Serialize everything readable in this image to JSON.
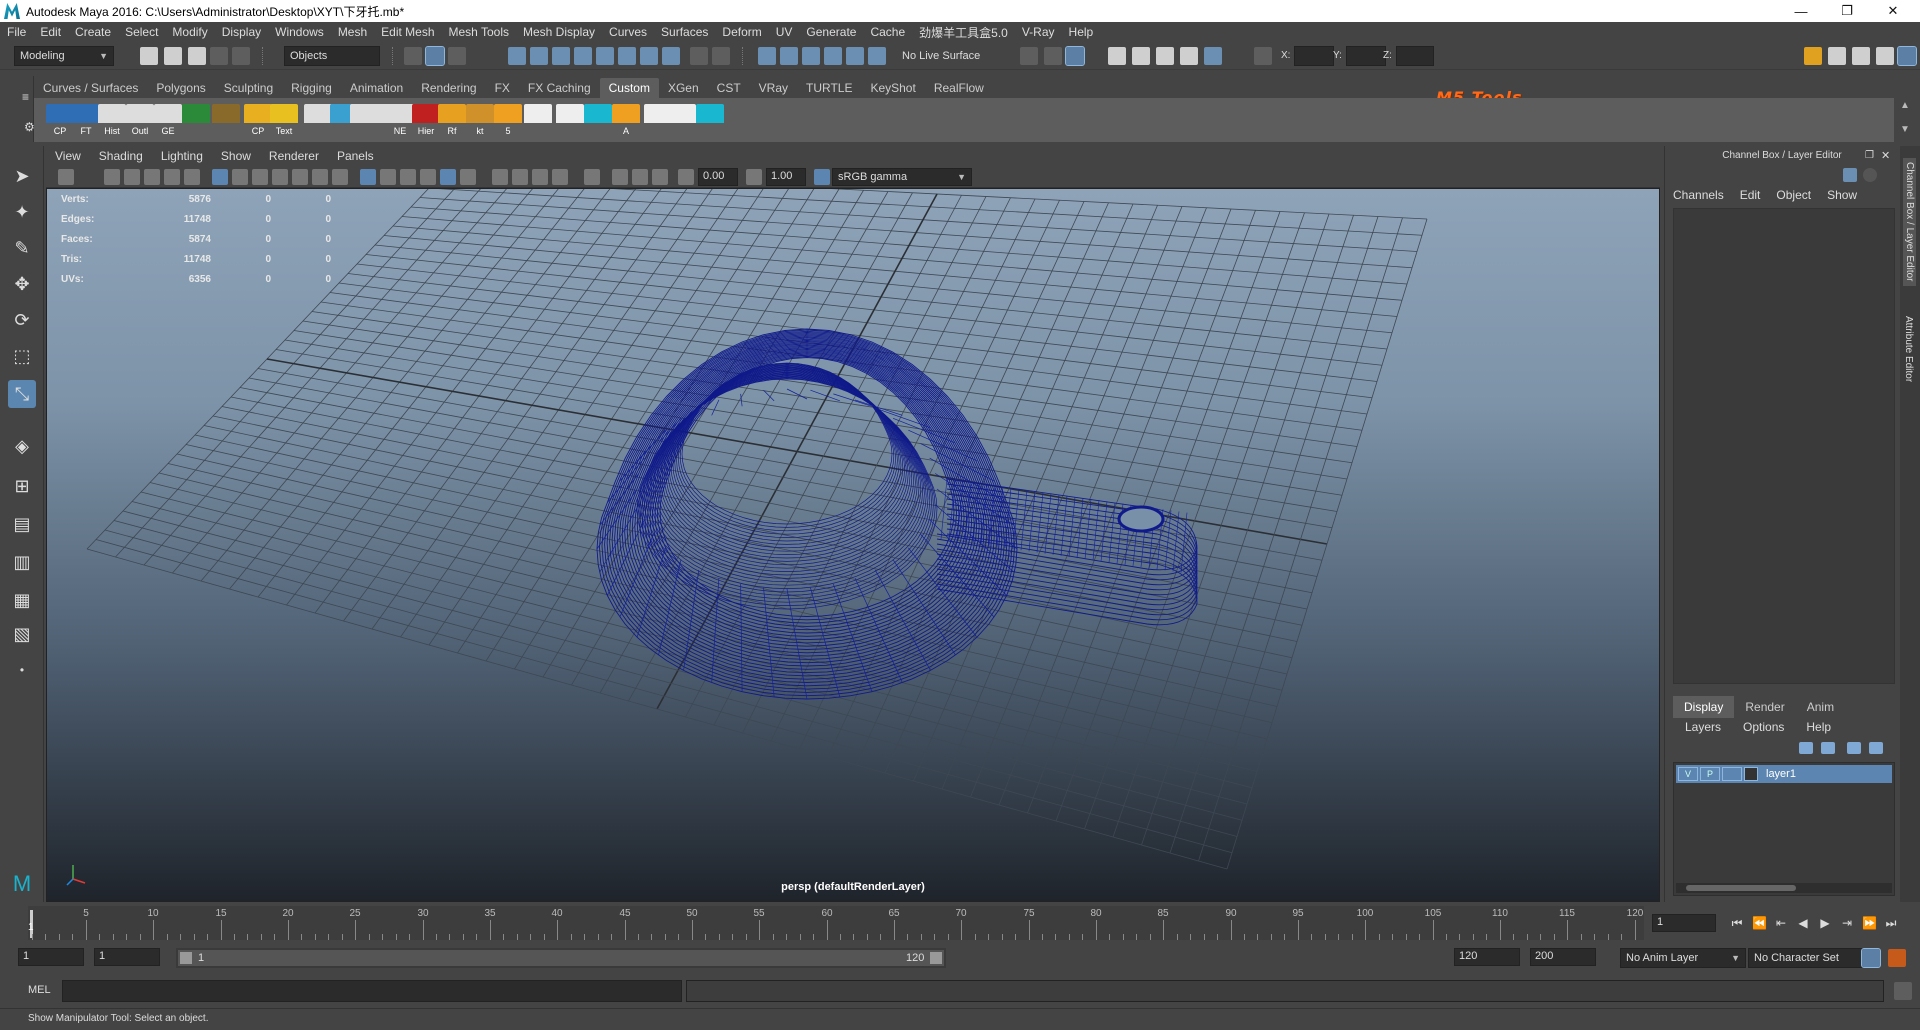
{
  "window": {
    "title": "Autodesk Maya 2016: C:\\Users\\Administrator\\Desktop\\XYT\\下牙托.mb*",
    "minimize": "—",
    "restore": "❐",
    "close": "✕"
  },
  "menu": [
    "File",
    "Edit",
    "Create",
    "Select",
    "Modify",
    "Display",
    "Windows",
    "Mesh",
    "Edit Mesh",
    "Mesh Tools",
    "Mesh Display",
    "Curves",
    "Surfaces",
    "Deform",
    "UV",
    "Generate",
    "Cache",
    "劲爆羊工具盒5.0",
    "V-Ray",
    "Help"
  ],
  "status": {
    "mode": "Modeling",
    "selmask": "Objects",
    "live_surface": "No Live Surface",
    "x_label": "X:",
    "y_label": "Y:",
    "z_label": "Z:",
    "brand": "M5 Tools"
  },
  "shelf": {
    "tabs": [
      "Curves / Surfaces",
      "Polygons",
      "Sculpting",
      "Rigging",
      "Animation",
      "Rendering",
      "FX",
      "FX Caching",
      "Custom",
      "XGen",
      "CST",
      "VRay",
      "TURTLE",
      "KeyShot",
      "RealFlow"
    ],
    "active_tab": "Custom",
    "icons": [
      "CP",
      "FT",
      "Hist",
      "Outl",
      "GE",
      "",
      "",
      "CP",
      "Text",
      "",
      "",
      "",
      "",
      "NE",
      "Hier",
      "Rf",
      "kt",
      "5",
      "",
      "",
      "",
      "A",
      "",
      "",
      ""
    ]
  },
  "viewport": {
    "menu": [
      "View",
      "Shading",
      "Lighting",
      "Show",
      "Renderer",
      "Panels"
    ],
    "exposure": "0.00",
    "gamma": "1.00",
    "colorspace": "sRGB gamma",
    "camera_label": "persp (defaultRenderLayer)",
    "hud": [
      {
        "label": "Verts:",
        "a": "5876",
        "b": "0",
        "c": "0"
      },
      {
        "label": "Edges:",
        "a": "11748",
        "b": "0",
        "c": "0"
      },
      {
        "label": "Faces:",
        "a": "5874",
        "b": "0",
        "c": "0"
      },
      {
        "label": "Tris:",
        "a": "11748",
        "b": "0",
        "c": "0"
      },
      {
        "label": "UVs:",
        "a": "6356",
        "b": "0",
        "c": "0"
      }
    ]
  },
  "channelbox": {
    "title": "Channel Box / Layer Editor",
    "menu": [
      "Channels",
      "Edit",
      "Object",
      "Show"
    ],
    "tabs": [
      "Display",
      "Render",
      "Anim"
    ],
    "active_tab": "Display",
    "layer_menu": [
      "Layers",
      "Options",
      "Help"
    ],
    "layer": {
      "v": "V",
      "p": "P",
      "name": "layer1"
    },
    "side_tab_1": "Channel Box / Layer Editor",
    "side_tab_2": "Attribute Editor"
  },
  "timeline": {
    "ticks": [
      "5",
      "10",
      "15",
      "20",
      "25",
      "30",
      "35",
      "40",
      "45",
      "50",
      "55",
      "60",
      "65",
      "70",
      "75",
      "80",
      "85",
      "90",
      "95",
      "100",
      "105",
      "110",
      "115",
      "120"
    ],
    "start_mark": "1",
    "current_frame": "1"
  },
  "range": {
    "start": "1",
    "playback_start": "1",
    "slider_start": "1",
    "slider_end": "120",
    "playback_end": "120",
    "end": "200",
    "anim_layer": "No Anim Layer",
    "char_set": "No Character Set"
  },
  "command": {
    "lang": "MEL"
  },
  "help": {
    "text": "Show Manipulator Tool: Select an object."
  }
}
